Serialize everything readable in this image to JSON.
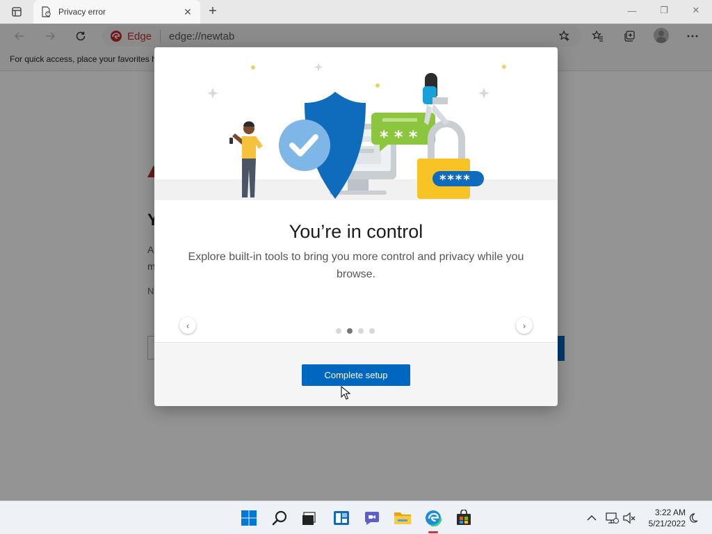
{
  "browser": {
    "tab_title": "Privacy error",
    "tab_close": "✕",
    "new_tab": "+",
    "address_brand": "Edge",
    "address_url": "edge://newtab",
    "favorites_bar_text": "For quick access, place your favorites h"
  },
  "window_controls": {
    "minimize": "—",
    "restore": "❐",
    "close": "✕"
  },
  "background_page": {
    "heading_fragment": "Y",
    "line1_fragment": "A",
    "line2_fragment": "m",
    "line3_fragment": "N",
    "trailing_fragment": "."
  },
  "modal": {
    "title": "You’re in control",
    "description": "Explore built-in tools to bring you more control and privacy while you browse.",
    "prev_arrow": "‹",
    "next_arrow": "›",
    "active_page": 2,
    "total_pages": 4,
    "cta_label": "Complete setup",
    "password_badge": "****",
    "chat_password": "* * *"
  },
  "taskbar": {
    "time": "3:22 AM",
    "date": "5/21/2022",
    "apps": [
      "start-icon",
      "search-icon",
      "task-view-icon",
      "widgets-icon",
      "chat-icon",
      "file-explorer-icon",
      "edge-icon",
      "store-icon"
    ]
  },
  "colors": {
    "accent": "#0067c0",
    "edge_red": "#c4262e",
    "shield_blue": "#0f6cbd",
    "chat_green": "#8cc63f",
    "lock_yellow": "#f7c325"
  }
}
